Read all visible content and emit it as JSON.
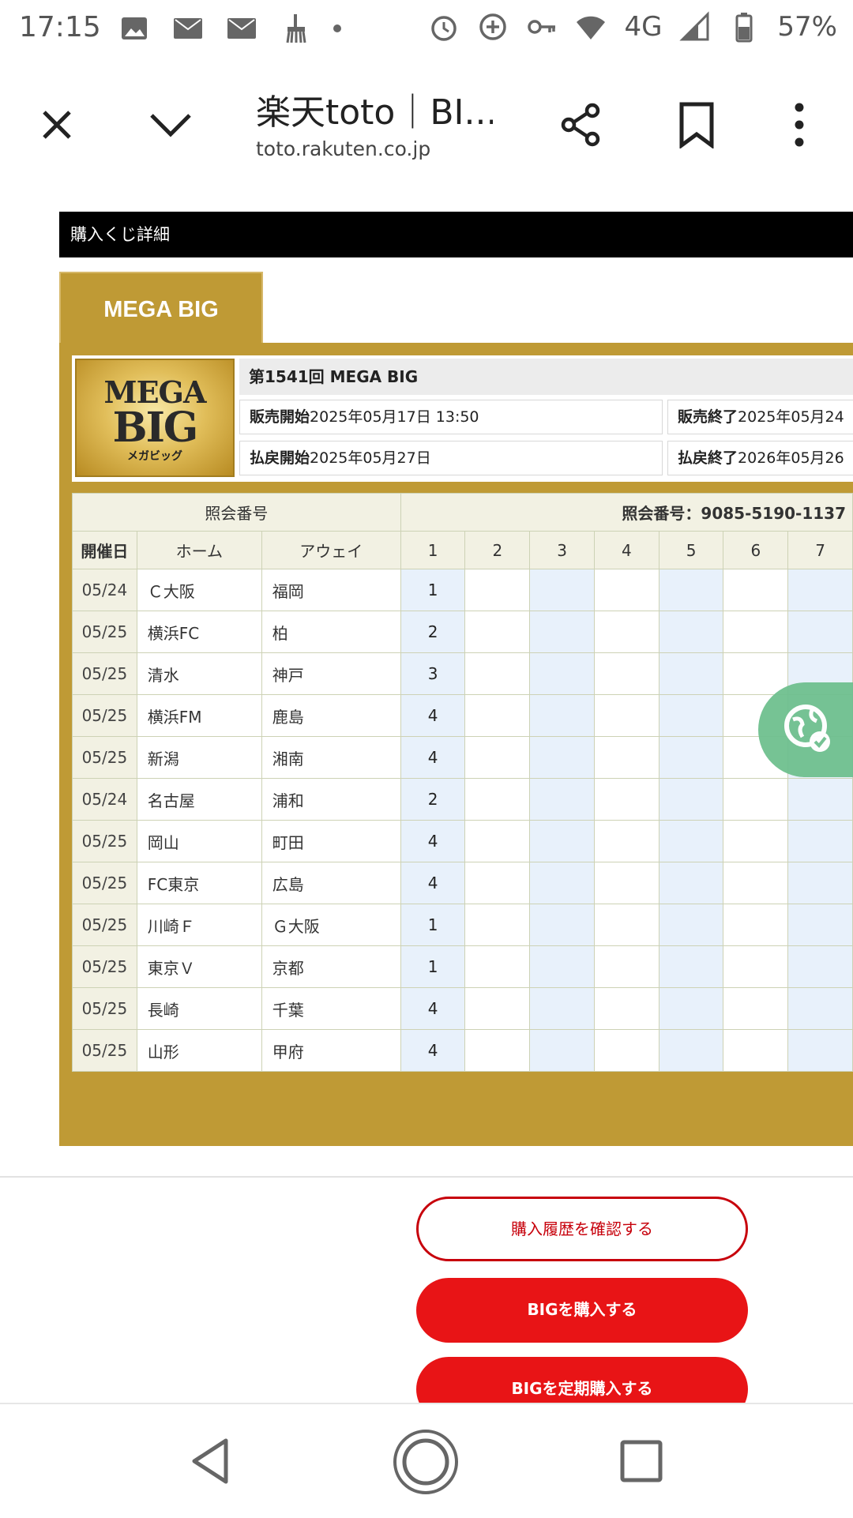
{
  "status_bar": {
    "time": "17:15",
    "network": "4G",
    "battery": "57%",
    "icons_left": [
      "image-icon",
      "au-mail-icon",
      "au-mail-icon",
      "cleaner-icon",
      "dot-icon"
    ],
    "icons_right": [
      "alarm-icon",
      "data-saver-icon",
      "vpn-key-icon",
      "wifi-icon",
      "signal-icon",
      "battery-icon"
    ]
  },
  "browser": {
    "title": "楽天toto｜BI...",
    "url": "toto.rakuten.co.jp"
  },
  "page": {
    "section_title": "購入くじ詳細",
    "product_tab": "MEGA BIG",
    "logo_text_1": "MEGA",
    "logo_text_2": "BIG",
    "logo_text_3": "メガビッグ",
    "round": "第1541回 MEGA BIG",
    "sale_start_label": "販売開始",
    "sale_start": "2025年05月17日 13:50",
    "sale_end_label": "販売終了",
    "sale_end": "2025年05月24",
    "refund_start_label": "払戻開始",
    "refund_start": "2025年05月27日",
    "refund_end_label": "払戻終了",
    "refund_end": "2026年05月26",
    "ref_header": "照会番号",
    "ref_number": "照会番号：9085-5190-1137",
    "col_date": "開催日",
    "col_home": "ホーム",
    "col_away": "アウェイ",
    "pick_columns": [
      "1",
      "2",
      "3",
      "4",
      "5",
      "6",
      "7"
    ],
    "matches": [
      {
        "date": "05/24",
        "home": "Ｃ大阪",
        "away": "福岡",
        "pick": "1"
      },
      {
        "date": "05/25",
        "home": "横浜FC",
        "away": "柏",
        "pick": "2"
      },
      {
        "date": "05/25",
        "home": "清水",
        "away": "神戸",
        "pick": "3"
      },
      {
        "date": "05/25",
        "home": "横浜FM",
        "away": "鹿島",
        "pick": "4"
      },
      {
        "date": "05/25",
        "home": "新潟",
        "away": "湘南",
        "pick": "4"
      },
      {
        "date": "05/24",
        "home": "名古屋",
        "away": "浦和",
        "pick": "2"
      },
      {
        "date": "05/25",
        "home": "岡山",
        "away": "町田",
        "pick": "4"
      },
      {
        "date": "05/25",
        "home": "FC東京",
        "away": "広島",
        "pick": "4"
      },
      {
        "date": "05/25",
        "home": "川崎Ｆ",
        "away": "Ｇ大阪",
        "pick": "1"
      },
      {
        "date": "05/25",
        "home": "東京Ｖ",
        "away": "京都",
        "pick": "1"
      },
      {
        "date": "05/25",
        "home": "長崎",
        "away": "千葉",
        "pick": "4"
      },
      {
        "date": "05/25",
        "home": "山形",
        "away": "甲府",
        "pick": "4"
      }
    ],
    "buttons": {
      "history": "購入履歴を確認する",
      "buy": "BIGを購入する",
      "subscribe": "BIGを定期購入する"
    }
  },
  "colors": {
    "gold": "#bf9a35",
    "red": "#e81416",
    "shaded_column": "#e8f1fb"
  }
}
